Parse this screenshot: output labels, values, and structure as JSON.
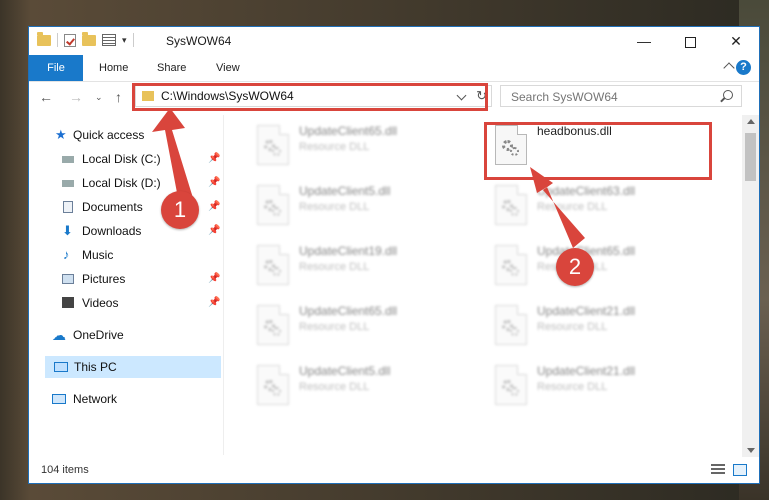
{
  "window": {
    "title": "SysWOW64"
  },
  "window_controls": {
    "minimize": "—",
    "maximize": "",
    "close": "✕"
  },
  "ribbon": {
    "tabs": [
      "File",
      "Home",
      "Share",
      "View"
    ],
    "help": "?"
  },
  "address": {
    "path": "C:\\Windows\\SysWOW64",
    "refresh": "↻"
  },
  "search": {
    "placeholder": "Search SysWOW64"
  },
  "nav": {
    "back": "←",
    "forward": "→",
    "recent": "⌄",
    "up": "↑"
  },
  "sidebar": {
    "quick_access": "Quick access",
    "items": [
      {
        "label": "Local Disk (C:)",
        "icon": "drive-icon"
      },
      {
        "label": "Local Disk (D:)",
        "icon": "drive-icon"
      },
      {
        "label": "Documents",
        "icon": "documents-icon"
      },
      {
        "label": "Downloads",
        "icon": "downloads-icon"
      },
      {
        "label": "Music",
        "icon": "music-icon"
      },
      {
        "label": "Pictures",
        "icon": "pictures-icon"
      },
      {
        "label": "Videos",
        "icon": "videos-icon"
      }
    ],
    "onedrive": "OneDrive",
    "this_pc": "This PC",
    "network": "Network"
  },
  "files": [
    {
      "name": "UpdateClient65.dll",
      "type": "Resource DLL"
    },
    {
      "name": "headbonus.dll",
      "type": ""
    },
    {
      "name": "UpdateClient5.dll",
      "type": "Resource DLL"
    },
    {
      "name": "UpdateClient63.dll",
      "type": "Resource DLL"
    },
    {
      "name": "UpdateClient19.dll",
      "type": "Resource DLL"
    },
    {
      "name": "UpdateClient65.dll",
      "type": "Resource DLL"
    },
    {
      "name": "UpdateClient65.dll",
      "type": "Resource DLL"
    },
    {
      "name": "UpdateClient21.dll",
      "type": "Resource DLL"
    },
    {
      "name": "UpdateClient5.dll",
      "type": "Resource DLL"
    },
    {
      "name": "UpdateClient21.dll",
      "type": "Resource DLL"
    }
  ],
  "status": {
    "item_count": "104 items"
  },
  "annotations": {
    "badge1": "1",
    "badge2": "2",
    "color": "#d9453c"
  }
}
